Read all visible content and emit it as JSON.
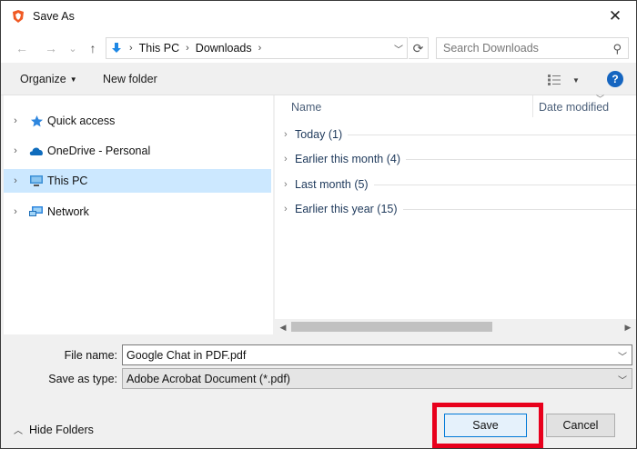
{
  "window": {
    "title": "Save As",
    "close_label": "✕"
  },
  "navbar": {
    "back": "←",
    "forward": "→",
    "recent": "⌄",
    "up": "↑",
    "breadcrumbs": [
      "This PC",
      "Downloads"
    ],
    "refresh": "⟳",
    "search_placeholder": "Search Downloads"
  },
  "toolbar": {
    "organize_label": "Organize",
    "new_folder_label": "New folder",
    "help_label": "?"
  },
  "navpane": {
    "items": [
      {
        "label": "Quick access",
        "icon": "star-icon",
        "selected": false
      },
      {
        "label": "OneDrive - Personal",
        "icon": "cloud-icon",
        "selected": false
      },
      {
        "label": "This PC",
        "icon": "computer-icon",
        "selected": true
      },
      {
        "label": "Network",
        "icon": "network-icon",
        "selected": false
      }
    ]
  },
  "filelist": {
    "columns": {
      "name": "Name",
      "date": "Date modified"
    },
    "groups": [
      {
        "label": "Today (1)"
      },
      {
        "label": "Earlier this month (4)"
      },
      {
        "label": "Last month (5)"
      },
      {
        "label": "Earlier this year (15)"
      }
    ]
  },
  "form": {
    "filename_label": "File name:",
    "filename_value": "Google Chat in PDF.pdf",
    "savetype_label": "Save as type:",
    "savetype_value": "Adobe Acrobat Document (*.pdf)"
  },
  "footer": {
    "hide_folders_label": "Hide Folders",
    "save_label": "Save",
    "cancel_label": "Cancel"
  },
  "colors": {
    "accent": "#0078d7",
    "highlight": "#e8001c",
    "selection": "#cce8ff"
  }
}
